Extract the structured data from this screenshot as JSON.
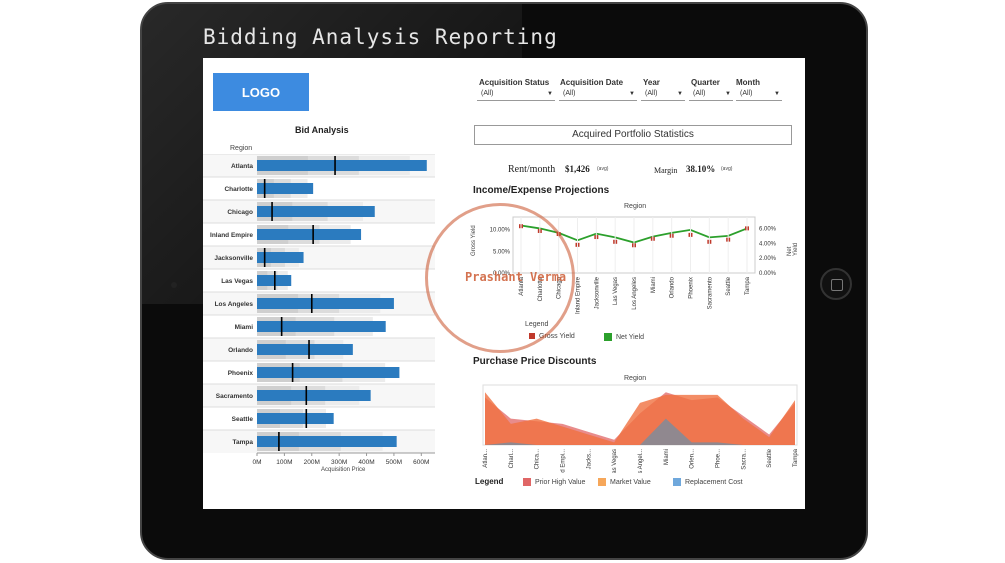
{
  "header": {
    "title": "Bidding Analysis Reporting",
    "logo": "LOGO"
  },
  "filters": [
    {
      "label": "Acquisition Status",
      "value": "(All)"
    },
    {
      "label": "Acquisition Date",
      "value": "(All)"
    },
    {
      "label": "Year",
      "value": "(All)"
    },
    {
      "label": "Quarter",
      "value": "(All)"
    },
    {
      "label": "Month",
      "value": "(All)"
    }
  ],
  "stats": {
    "title": "Acquired Portfolio Statistics",
    "rent_label": "Rent/month",
    "rent_value": "$1,426",
    "rent_note": "(avg)",
    "margin_label": "Margin",
    "margin_value": "38.10%",
    "margin_note": "(avg)"
  },
  "bid_analysis": {
    "title": "Bid Analysis",
    "region_header": "Region",
    "x_title": "Acquisition Price",
    "x_ticks": [
      "0M",
      "100M",
      "200M",
      "300M",
      "400M",
      "500M",
      "600M"
    ],
    "regions": [
      "Atlanta",
      "Charlotte",
      "Chicago",
      "Inland Empire",
      "Jacksonville",
      "Las Vegas",
      "Los Angeles",
      "Miami",
      "Orlando",
      "Phoenix",
      "Sacramento",
      "Seattle",
      "Tampa"
    ]
  },
  "income": {
    "title": "Income/Expense Projections",
    "region_header": "Region",
    "left_axis_title": "Gross Yield",
    "right_axis_title": "Net Yield",
    "left_ticks": [
      "10.00%",
      "5.00%",
      "0.00%"
    ],
    "right_ticks": [
      "6.00%",
      "4.00%",
      "2.00%",
      "0.00%"
    ],
    "legend_title": "Legend",
    "legend": [
      {
        "name": "Gross Yield",
        "color": "#c0392b"
      },
      {
        "name": "Net Yield",
        "color": "#2ca02c"
      }
    ]
  },
  "purchase": {
    "title": "Purchase Price Discounts",
    "region_header": "Region",
    "x_labels": [
      "Atlan...",
      "Charl...",
      "Chica...",
      "Inland Empi...",
      "Jacks...",
      "Las Vegas",
      "Los Angel...",
      "Miami",
      "Orlen...",
      "Phoe...",
      "Sacra...",
      "Seattle",
      "Tampa"
    ],
    "legend_title": "Legend",
    "legend": [
      {
        "name": "Prior High Value",
        "color": "#e06666"
      },
      {
        "name": "Market Value",
        "color": "#f6a75a"
      },
      {
        "name": "Replacement Cost",
        "color": "#6fa8dc"
      }
    ]
  },
  "watermark": "Prashant Verma",
  "chart_data": [
    {
      "type": "bar",
      "title": "Bid Analysis",
      "xlabel": "Acquisition Price",
      "categories": [
        "Atlanta",
        "Charlotte",
        "Chicago",
        "Inland Empire",
        "Jacksonville",
        "Las Vegas",
        "Los Angeles",
        "Miami",
        "Orlando",
        "Phoenix",
        "Sacramento",
        "Seattle",
        "Tampa"
      ],
      "values": [
        620,
        205,
        430,
        380,
        170,
        125,
        500,
        470,
        350,
        520,
        415,
        280,
        510
      ],
      "target": [
        285,
        28,
        55,
        205,
        28,
        65,
        200,
        90,
        190,
        130,
        180,
        180,
        80
      ],
      "xlim": [
        0,
        650
      ]
    },
    {
      "type": "line",
      "title": "Income/Expense Projections",
      "categories": [
        "Atlanta",
        "Charlotte",
        "Chicago",
        "Inland Empire",
        "Jacksonville",
        "Las Vegas",
        "Los Angeles",
        "Miami",
        "Orlando",
        "Phoenix",
        "Sacramento",
        "Seattle",
        "Tampa"
      ],
      "series": [
        {
          "name": "Gross Yield",
          "values": [
            10.8,
            9.7,
            9.0,
            6.5,
            8.3,
            7.2,
            6.4,
            7.9,
            8.6,
            8.8,
            7.2,
            7.7,
            10.3
          ]
        },
        {
          "name": "Net Yield",
          "values": [
            6.4,
            6.0,
            5.4,
            4.4,
            5.3,
            4.8,
            4.1,
            4.9,
            5.4,
            5.8,
            4.8,
            5.0,
            6.0
          ]
        }
      ]
    },
    {
      "type": "area",
      "title": "Purchase Price Discounts",
      "categories": [
        "Atlanta",
        "Charlotte",
        "Chicago",
        "Inland Empire",
        "Jacksonville",
        "Las Vegas",
        "Los Angeles",
        "Miami",
        "Orlando",
        "Phoenix",
        "Sacramento",
        "Seattle",
        "Tampa"
      ],
      "series": [
        {
          "name": "Prior High Value",
          "values": [
            90,
            50,
            45,
            40,
            25,
            10,
            60,
            100,
            85,
            90,
            55,
            20,
            80
          ]
        },
        {
          "name": "Market Value",
          "values": [
            100,
            40,
            50,
            35,
            20,
            5,
            80,
            95,
            95,
            95,
            50,
            15,
            85
          ]
        },
        {
          "name": "Replacement Cost",
          "values": [
            0,
            5,
            0,
            0,
            0,
            0,
            0,
            50,
            5,
            5,
            0,
            0,
            0
          ]
        }
      ]
    }
  ]
}
